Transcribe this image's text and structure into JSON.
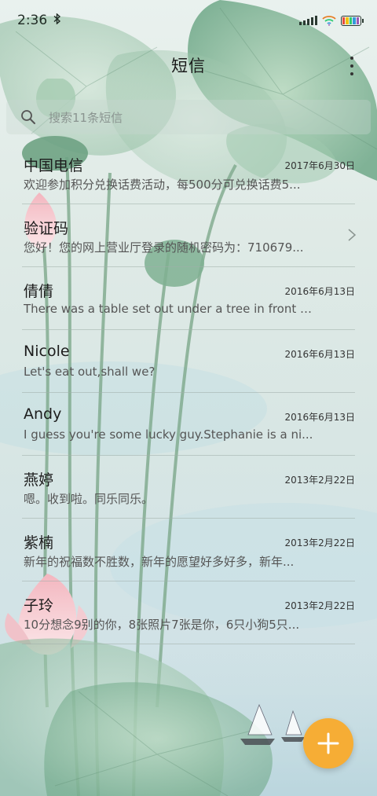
{
  "status_bar": {
    "time": "2:36",
    "bluetooth_icon": "bluetooth-icon",
    "battery_colors": [
      "#e74c3c",
      "#f1c40f",
      "#2ecc71",
      "#3498db",
      "#9b59b6"
    ]
  },
  "header": {
    "title": "短信",
    "more_icon": "more-vertical-icon"
  },
  "search": {
    "placeholder": "搜索11条短信",
    "icon": "search-icon"
  },
  "messages": [
    {
      "name": "中国电信",
      "date": "2017年6月30日",
      "preview": "欢迎参加积分兑换话费活动，每500分可兑换话费5..."
    },
    {
      "name": "验证码",
      "date": "",
      "preview": "您好！您的网上营业厅登录的随机密码为：710679...",
      "has_chevron": true
    },
    {
      "name": "倩倩",
      "date": "2016年6月13日",
      "preview": "There was a table set out under a tree in front of ..."
    },
    {
      "name": "Nicole",
      "date": "2016年6月13日",
      "preview": "Let's eat out,shall we?"
    },
    {
      "name": "Andy",
      "date": "2016年6月13日",
      "preview": "I guess you're some lucky guy.Stephanie is a ni..."
    },
    {
      "name": "燕婷",
      "date": "2013年2月22日",
      "preview": "嗯。收到啦。同乐同乐。"
    },
    {
      "name": "紫楠",
      "date": "2013年2月22日",
      "preview": "新年的祝福数不胜数，新年的愿望好多好多，新年..."
    },
    {
      "name": "子玲",
      "date": "2013年2月22日",
      "preview": "10分想念9别的你，8张照片7张是你，6只小狗5只..."
    }
  ],
  "fab": {
    "icon": "plus-icon",
    "color": "#f6ad35"
  }
}
